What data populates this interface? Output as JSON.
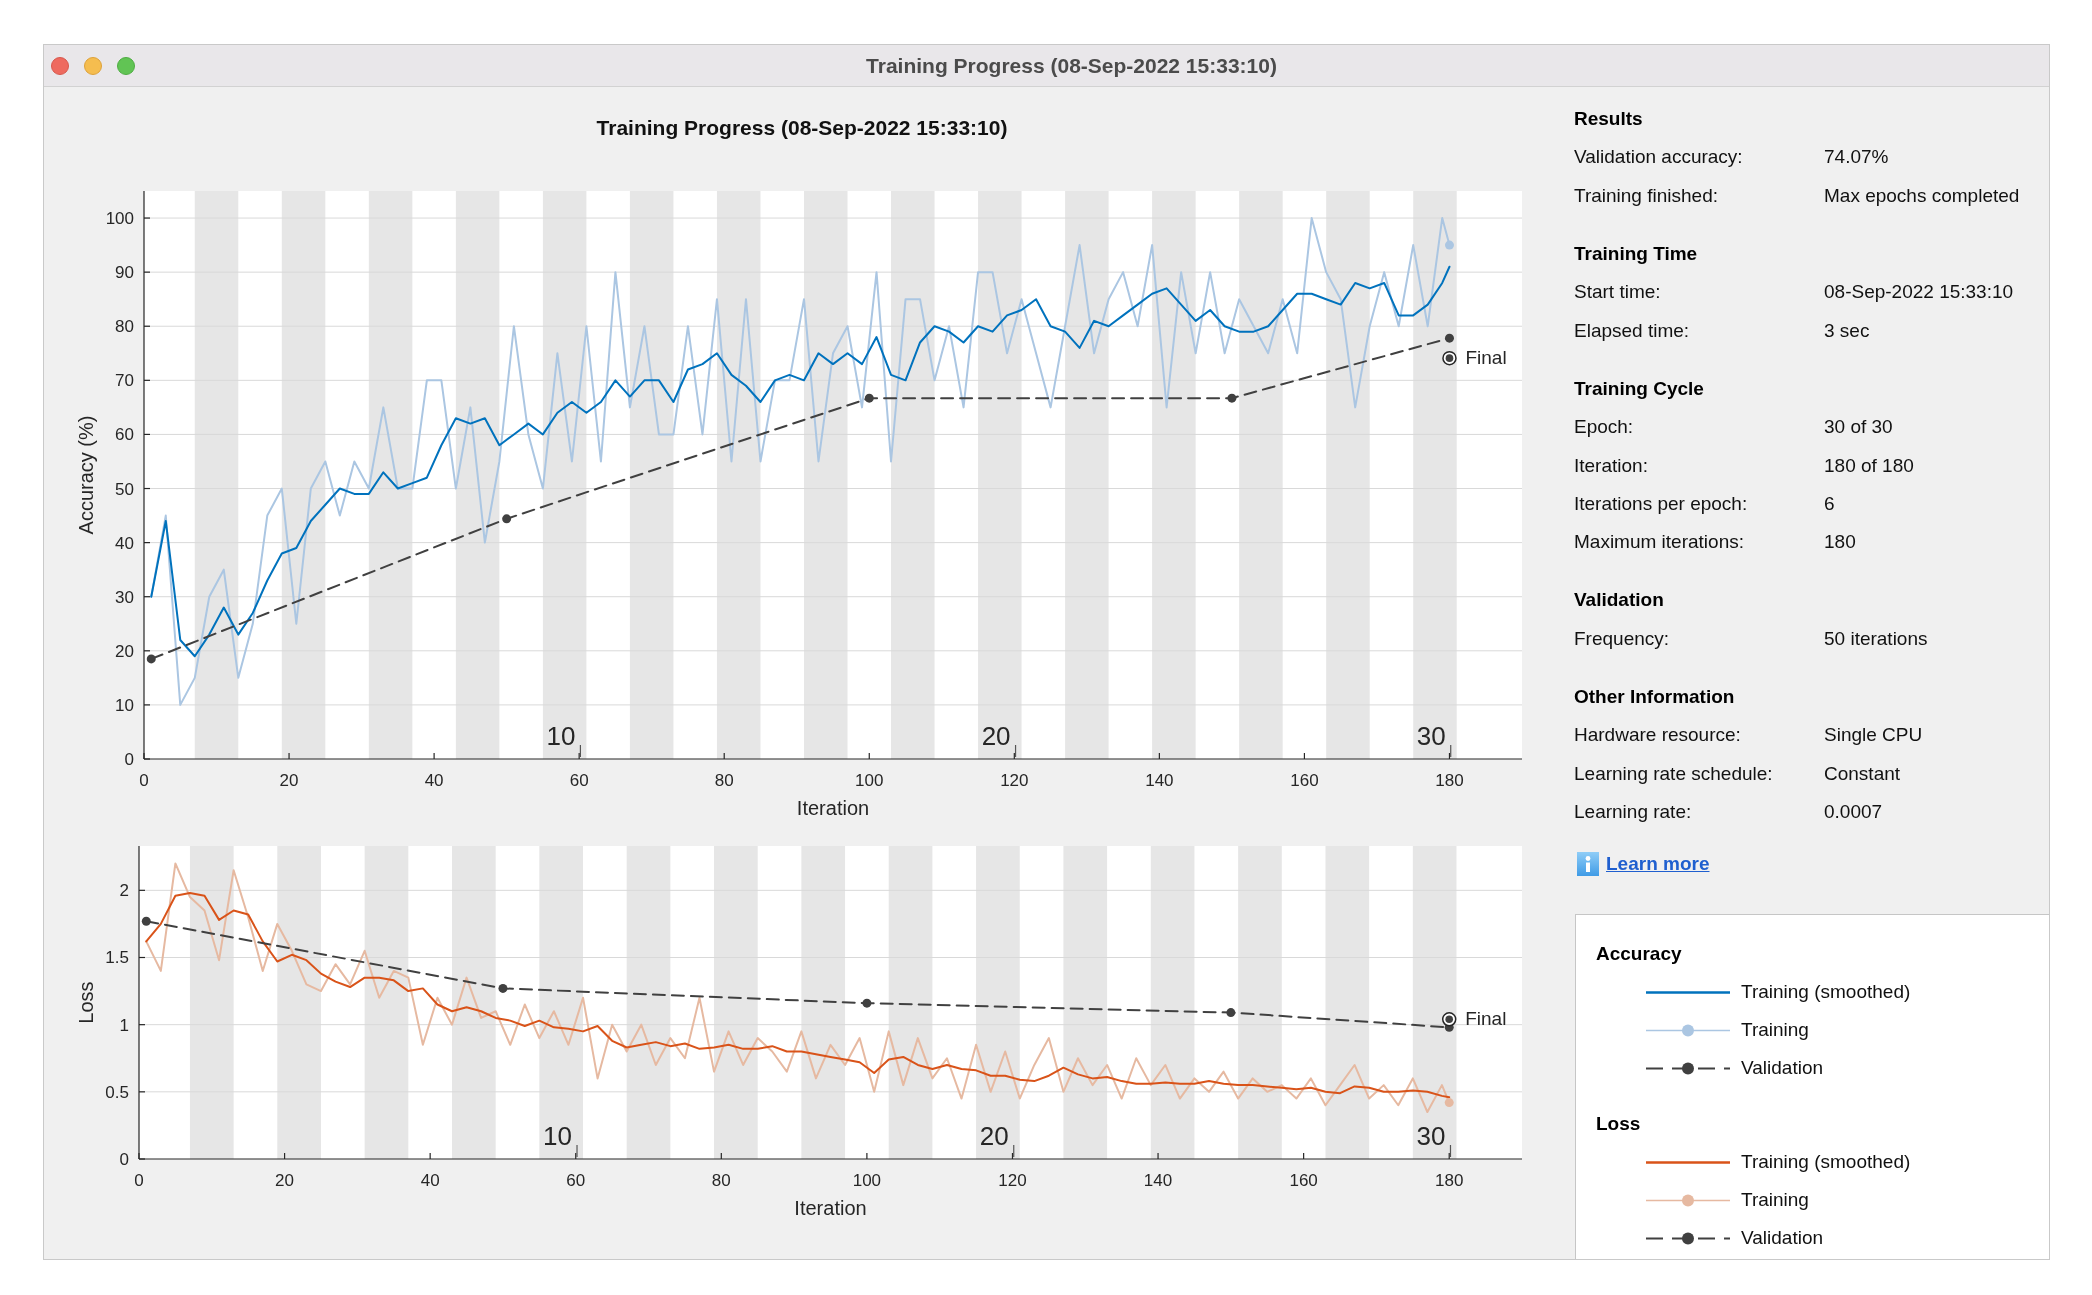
{
  "window": {
    "title": "Training Progress (08-Sep-2022 15:33:10)"
  },
  "figure": {
    "title": "Training Progress (08-Sep-2022 15:33:10)",
    "charts": [
      {
        "chart_data": {
          "type": "line",
          "xlabel": "Iteration",
          "ylabel": "Accuracy (%)",
          "x": [
            1,
            3,
            5,
            7,
            9,
            11,
            13,
            15,
            17,
            19,
            21,
            23,
            25,
            27,
            29,
            31,
            33,
            35,
            37,
            39,
            41,
            43,
            45,
            47,
            49,
            51,
            53,
            55,
            57,
            59,
            61,
            63,
            65,
            67,
            69,
            71,
            73,
            75,
            77,
            79,
            81,
            83,
            85,
            87,
            89,
            91,
            93,
            95,
            97,
            99,
            101,
            103,
            105,
            107,
            109,
            111,
            113,
            115,
            117,
            119,
            121,
            123,
            125,
            127,
            129,
            131,
            133,
            135,
            137,
            139,
            141,
            143,
            145,
            147,
            149,
            151,
            153,
            155,
            157,
            159,
            161,
            163,
            165,
            167,
            169,
            171,
            173,
            175,
            177,
            179,
            180
          ],
          "series": [
            {
              "name": "Training (smoothed)",
              "color": "#0072bd",
              "line_style": "solid",
              "marker": "none",
              "values": [
                30,
                44,
                22,
                19,
                23,
                28,
                23,
                27,
                33,
                38,
                39,
                44,
                47,
                50,
                49,
                49,
                53,
                50,
                51,
                52,
                58,
                63,
                62,
                63,
                58,
                60,
                62,
                60,
                64,
                66,
                64,
                66,
                70,
                67,
                70,
                70,
                66,
                72,
                73,
                75,
                71,
                69,
                66,
                70,
                71,
                70,
                75,
                73,
                75,
                73,
                78,
                71,
                70,
                77,
                80,
                79,
                77,
                80,
                79,
                82,
                83,
                85,
                80,
                79,
                76,
                81,
                80,
                82,
                84,
                86,
                87,
                84,
                81,
                83,
                80,
                79,
                79,
                80,
                83,
                86,
                86,
                85,
                84,
                88,
                87,
                88,
                82,
                82,
                84,
                88,
                91
              ]
            },
            {
              "name": "Training",
              "color": "#abc6e2",
              "line_style": "solid",
              "marker": "none",
              "values": [
                30,
                45,
                10,
                15,
                30,
                35,
                15,
                25,
                45,
                50,
                25,
                50,
                55,
                45,
                55,
                50,
                65,
                50,
                50,
                70,
                70,
                50,
                65,
                40,
                55,
                80,
                60,
                50,
                75,
                55,
                80,
                55,
                90,
                65,
                80,
                60,
                60,
                80,
                60,
                85,
                55,
                85,
                55,
                70,
                70,
                85,
                55,
                75,
                80,
                65,
                90,
                55,
                85,
                85,
                70,
                80,
                65,
                90,
                90,
                75,
                85,
                75,
                65,
                80,
                95,
                75,
                85,
                90,
                80,
                95,
                65,
                90,
                75,
                90,
                75,
                85,
                80,
                75,
                85,
                75,
                100,
                90,
                85,
                65,
                80,
                90,
                80,
                95,
                80,
                100,
                95
              ]
            },
            {
              "name": "Validation",
              "color": "#404040",
              "line_style": "dashed",
              "marker": "circle",
              "x": [
                1,
                50,
                100,
                150,
                180
              ],
              "values": [
                18.5,
                44.4,
                66.7,
                66.7,
                77.8
              ]
            },
            {
              "color": "#abc6e2",
              "line_style": "none",
              "marker": "circle",
              "x": [
                180
              ],
              "values": [
                95
              ]
            }
          ],
          "xlim": [
            0,
            190
          ],
          "ylim": [
            0,
            105
          ],
          "xticks": [
            0,
            20,
            40,
            60,
            80,
            100,
            120,
            140,
            160,
            180
          ],
          "yticks": [
            0,
            10,
            20,
            30,
            40,
            50,
            60,
            70,
            80,
            90,
            100
          ],
          "grid": true,
          "bands": [
            {
              "axis": "x",
              "from": 7,
              "to": 13
            },
            {
              "axis": "x",
              "from": 19,
              "to": 25
            },
            {
              "axis": "x",
              "from": 31,
              "to": 37
            },
            {
              "axis": "x",
              "from": 43,
              "to": 49
            },
            {
              "axis": "x",
              "from": 55,
              "to": 61,
              "label": "10"
            },
            {
              "axis": "x",
              "from": 67,
              "to": 73
            },
            {
              "axis": "x",
              "from": 79,
              "to": 85
            },
            {
              "axis": "x",
              "from": 91,
              "to": 97
            },
            {
              "axis": "x",
              "from": 103,
              "to": 109
            },
            {
              "axis": "x",
              "from": 115,
              "to": 121,
              "label": "20"
            },
            {
              "axis": "x",
              "from": 127,
              "to": 133
            },
            {
              "axis": "x",
              "from": 139,
              "to": 145
            },
            {
              "axis": "x",
              "from": 151,
              "to": 157
            },
            {
              "axis": "x",
              "from": 163,
              "to": 169
            },
            {
              "axis": "x",
              "from": 175,
              "to": 181,
              "label": "30"
            }
          ],
          "annotations": [
            {
              "x": 180,
              "y": 74.1,
              "text": "Final"
            }
          ]
        }
      },
      {
        "chart_data": {
          "type": "line",
          "xlabel": "Iteration",
          "ylabel": "Loss",
          "x": [
            1,
            3,
            5,
            7,
            9,
            11,
            13,
            15,
            17,
            19,
            21,
            23,
            25,
            27,
            29,
            31,
            33,
            35,
            37,
            39,
            41,
            43,
            45,
            47,
            49,
            51,
            53,
            55,
            57,
            59,
            61,
            63,
            65,
            67,
            69,
            71,
            73,
            75,
            77,
            79,
            81,
            83,
            85,
            87,
            89,
            91,
            93,
            95,
            97,
            99,
            101,
            103,
            105,
            107,
            109,
            111,
            113,
            115,
            117,
            119,
            121,
            123,
            125,
            127,
            129,
            131,
            133,
            135,
            137,
            139,
            141,
            143,
            145,
            147,
            149,
            151,
            153,
            155,
            157,
            159,
            161,
            163,
            165,
            167,
            169,
            171,
            173,
            175,
            177,
            179,
            180
          ],
          "series": [
            {
              "name": "Training (smoothed)",
              "color": "#d95319",
              "line_style": "solid",
              "marker": "none",
              "values": [
                1.62,
                1.75,
                1.96,
                1.98,
                1.96,
                1.78,
                1.85,
                1.82,
                1.62,
                1.47,
                1.52,
                1.48,
                1.38,
                1.32,
                1.28,
                1.35,
                1.35,
                1.33,
                1.25,
                1.27,
                1.15,
                1.1,
                1.13,
                1.1,
                1.05,
                1.03,
                0.99,
                1.03,
                0.98,
                0.97,
                0.95,
                0.99,
                0.88,
                0.83,
                0.85,
                0.87,
                0.84,
                0.86,
                0.82,
                0.83,
                0.85,
                0.82,
                0.82,
                0.84,
                0.8,
                0.8,
                0.78,
                0.76,
                0.74,
                0.72,
                0.64,
                0.74,
                0.76,
                0.7,
                0.67,
                0.7,
                0.67,
                0.66,
                0.62,
                0.62,
                0.59,
                0.58,
                0.62,
                0.68,
                0.63,
                0.6,
                0.61,
                0.58,
                0.56,
                0.56,
                0.57,
                0.56,
                0.56,
                0.58,
                0.56,
                0.55,
                0.55,
                0.54,
                0.53,
                0.52,
                0.53,
                0.5,
                0.49,
                0.54,
                0.53,
                0.5,
                0.5,
                0.51,
                0.5,
                0.47,
                0.46
              ]
            },
            {
              "name": "Training",
              "color": "#e6b9a1",
              "line_style": "solid",
              "marker": "none",
              "values": [
                1.62,
                1.4,
                2.2,
                1.95,
                1.85,
                1.48,
                2.15,
                1.8,
                1.4,
                1.75,
                1.55,
                1.3,
                1.25,
                1.45,
                1.3,
                1.55,
                1.2,
                1.4,
                1.35,
                0.85,
                1.2,
                1,
                1.35,
                1.05,
                1.1,
                0.85,
                1.15,
                0.9,
                1.1,
                0.85,
                1.2,
                0.6,
                1,
                0.8,
                1,
                0.7,
                0.9,
                0.75,
                1.2,
                0.65,
                0.95,
                0.7,
                0.9,
                0.8,
                0.65,
                0.95,
                0.6,
                0.85,
                0.7,
                0.9,
                0.5,
                0.95,
                0.55,
                0.9,
                0.6,
                0.75,
                0.45,
                0.85,
                0.5,
                0.8,
                0.45,
                0.7,
                0.9,
                0.5,
                0.75,
                0.55,
                0.7,
                0.45,
                0.75,
                0.55,
                0.7,
                0.45,
                0.6,
                0.5,
                0.65,
                0.45,
                0.6,
                0.5,
                0.55,
                0.45,
                0.6,
                0.4,
                0.55,
                0.7,
                0.45,
                0.55,
                0.4,
                0.6,
                0.35,
                0.55,
                0.42
              ]
            },
            {
              "name": "Validation",
              "color": "#404040",
              "line_style": "dashed",
              "marker": "circle",
              "x": [
                1,
                50,
                100,
                150,
                180
              ],
              "values": [
                1.77,
                1.27,
                1.16,
                1.09,
                0.98
              ]
            },
            {
              "color": "#e6b9a1",
              "line_style": "none",
              "marker": "circle",
              "x": [
                180
              ],
              "values": [
                0.42
              ]
            }
          ],
          "xlim": [
            0,
            190
          ],
          "ylim": [
            0,
            2.33
          ],
          "xticks": [
            0,
            20,
            40,
            60,
            80,
            100,
            120,
            140,
            160,
            180
          ],
          "yticks": [
            0,
            0.5,
            1,
            1.5,
            2
          ],
          "grid": true,
          "bands": [
            {
              "axis": "x",
              "from": 7,
              "to": 13
            },
            {
              "axis": "x",
              "from": 19,
              "to": 25
            },
            {
              "axis": "x",
              "from": 31,
              "to": 37
            },
            {
              "axis": "x",
              "from": 43,
              "to": 49
            },
            {
              "axis": "x",
              "from": 55,
              "to": 61,
              "label": "10"
            },
            {
              "axis": "x",
              "from": 67,
              "to": 73
            },
            {
              "axis": "x",
              "from": 79,
              "to": 85
            },
            {
              "axis": "x",
              "from": 91,
              "to": 97
            },
            {
              "axis": "x",
              "from": 103,
              "to": 109
            },
            {
              "axis": "x",
              "from": 115,
              "to": 121,
              "label": "20"
            },
            {
              "axis": "x",
              "from": 127,
              "to": 133
            },
            {
              "axis": "x",
              "from": 139,
              "to": 145
            },
            {
              "axis": "x",
              "from": 151,
              "to": 157
            },
            {
              "axis": "x",
              "from": 163,
              "to": 169
            },
            {
              "axis": "x",
              "from": 175,
              "to": 181,
              "label": "30"
            }
          ],
          "annotations": [
            {
              "x": 180,
              "y": 1.04,
              "text": "Final"
            }
          ]
        }
      }
    ]
  },
  "info_panel": {
    "sections": [
      {
        "title": "Results",
        "rows": [
          {
            "label": "Validation accuracy:",
            "value": "74.07%"
          },
          {
            "label": "Training finished:",
            "value": "Max epochs completed"
          }
        ]
      },
      {
        "title": "Training Time",
        "rows": [
          {
            "label": "Start time:",
            "value": "08-Sep-2022 15:33:10"
          },
          {
            "label": "Elapsed time:",
            "value": "3 sec"
          }
        ]
      },
      {
        "title": "Training Cycle",
        "rows": [
          {
            "label": "Epoch:",
            "value": "30 of 30"
          },
          {
            "label": "Iteration:",
            "value": "180 of 180"
          },
          {
            "label": "Iterations per epoch:",
            "value": "6"
          },
          {
            "label": "Maximum iterations:",
            "value": "180"
          }
        ]
      },
      {
        "title": "Validation",
        "rows": [
          {
            "label": "Frequency:",
            "value": "50 iterations"
          }
        ]
      },
      {
        "title": "Other Information",
        "rows": [
          {
            "label": "Hardware resource:",
            "value": "Single CPU"
          },
          {
            "label": "Learning rate schedule:",
            "value": "Constant"
          },
          {
            "label": "Learning rate:",
            "value": "0.0007"
          }
        ]
      }
    ],
    "link": {
      "label": "Learn more"
    }
  },
  "legend": {
    "sections": [
      {
        "title": "Accuracy"
      },
      {
        "title": "Loss"
      }
    ]
  }
}
